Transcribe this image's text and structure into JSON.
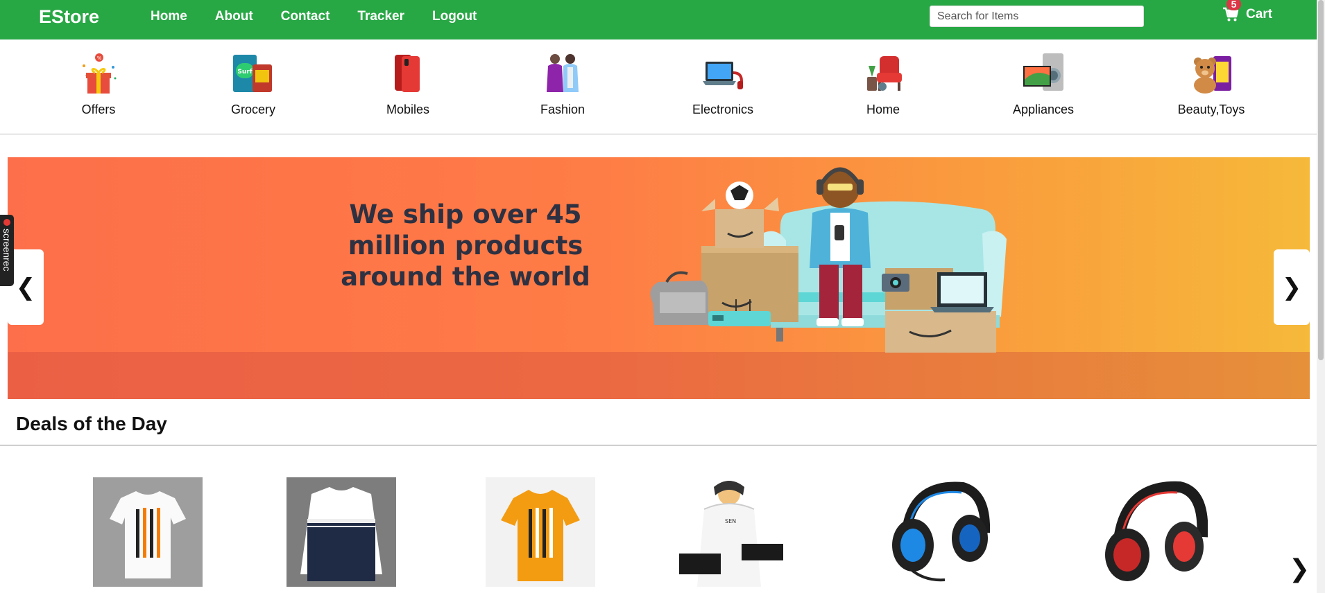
{
  "nav": {
    "brand": "EStore",
    "links": [
      "Home",
      "About",
      "Contact",
      "Tracker",
      "Logout"
    ],
    "search_placeholder": "Search for Items",
    "cart_label": "Cart",
    "cart_count": "5"
  },
  "categories": [
    "Offers",
    "Grocery",
    "Mobiles",
    "Fashion",
    "Electronics",
    "Home",
    "Appliances",
    "Beauty,Toys"
  ],
  "carousel": {
    "headline": "We ship over 45 million products around the world",
    "prev_label": "❮",
    "next_label": "❯"
  },
  "deals": {
    "title": "Deals of the Day",
    "next_label": "❯",
    "products": [
      "white-tshirt",
      "navy-white-sweater",
      "orange-tshirt",
      "white-hoodie",
      "blue-gaming-headset",
      "red-gaming-headset"
    ]
  },
  "overlay": {
    "screenrec_label": "screenrec"
  },
  "colors": {
    "nav_bg": "#28a745",
    "badge": "#dc3545",
    "banner_start": "#fd6f4a",
    "banner_end": "#f6b93a"
  }
}
